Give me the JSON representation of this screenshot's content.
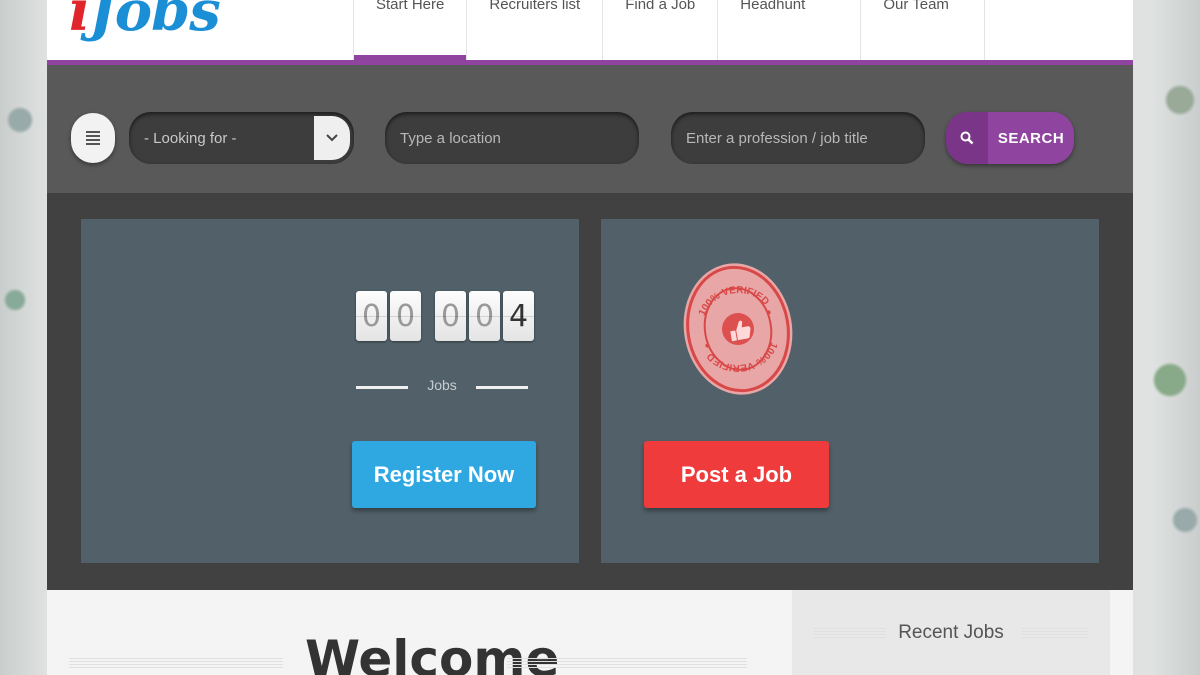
{
  "brand": {
    "logo_initial": "i",
    "logo_text": "Jobs"
  },
  "nav": {
    "items": [
      {
        "label": "Start Here",
        "active": true
      },
      {
        "label": "Recruiters list",
        "active": false
      },
      {
        "label": "Find a Job",
        "active": false
      },
      {
        "label": "Headhunt",
        "active": false
      },
      {
        "label": "Our Team",
        "active": false
      }
    ]
  },
  "search": {
    "looking_for": "- Looking for -",
    "location_placeholder": "Type a location",
    "profession_placeholder": "Enter a profession / job title",
    "button_label": "SEARCH"
  },
  "counter": {
    "digits": [
      "0",
      "0",
      "0",
      "0",
      "4"
    ],
    "label": "Jobs"
  },
  "actions": {
    "register_label": "Register Now",
    "post_label": "Post a Job"
  },
  "stamp": {
    "text": "100% VERIFIED"
  },
  "content": {
    "welcome": "Welcome",
    "recent_jobs": "Recent Jobs"
  },
  "colors": {
    "accent_purple": "#8f44a0",
    "register_blue": "#2fa8e2",
    "post_red": "#ef3b3b",
    "panel": "#516069"
  }
}
